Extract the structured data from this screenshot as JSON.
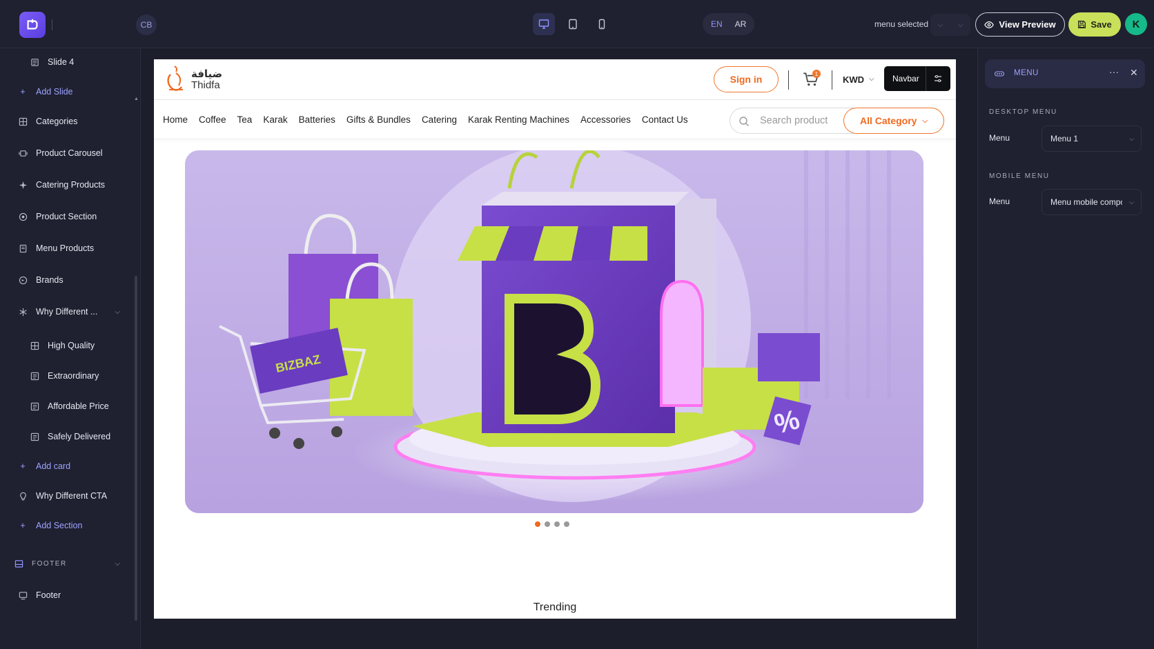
{
  "topbar": {
    "workspace_badge": "CB",
    "lang_en": "EN",
    "lang_ar": "AR",
    "menu_selected": "menu selected",
    "view_preview": "View Preview",
    "save": "Save",
    "avatar_initial": "K"
  },
  "sidebar": {
    "slide4": "Slide 4",
    "add_slide": "Add Slide",
    "categories": "Categories",
    "product_carousel": "Product Carousel",
    "catering_products": "Catering Products",
    "product_section": "Product Section",
    "menu_products": "Menu Products",
    "brands": "Brands",
    "why_different": "Why Different ...",
    "high_quality": "High Quality",
    "extraordinary": "Extraordinary",
    "affordable_price": "Affordable Price",
    "safely_delivered": "Safely Delivered",
    "add_card": "Add card",
    "why_different_cta": "Why Different CTA",
    "add_section": "Add Section",
    "footer_head": "FOOTER",
    "footer": "Footer"
  },
  "store": {
    "logo_ar": "ضيافة",
    "logo_en": "Thidfa",
    "sign_in": "Sign in",
    "cart_count": "1",
    "currency": "KWD",
    "navbar_label": "Navbar",
    "nav": [
      "Home",
      "Coffee",
      "Tea",
      "Karak",
      "Batteries",
      "Gifts & Bundles",
      "Catering",
      "Karak Renting Machines",
      "Accessories",
      "Contact Us"
    ],
    "search_placeholder": "Search product",
    "all_category": "All Category",
    "hero_cart_brand": "BIZBAZ",
    "hero_tag": "%",
    "trending": "Trending",
    "accent": "#ef6a1f"
  },
  "rpanel": {
    "title": "MENU",
    "desktop_menu": "DESKTOP MENU",
    "mobile_menu": "MOBILE MENU",
    "menu_label": "Menu",
    "desktop_value": "Menu 1",
    "mobile_value": "Menu mobile compo"
  }
}
